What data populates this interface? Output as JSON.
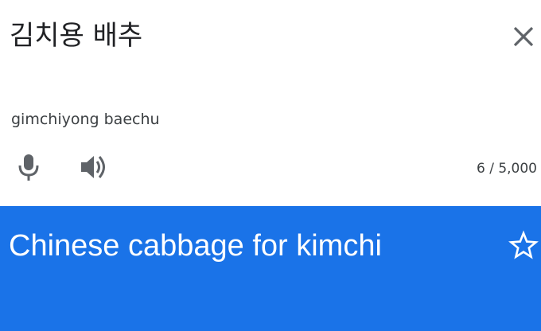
{
  "source": {
    "text": "김치용 배추",
    "transliteration": "gimchiyong baechu",
    "char_count": "6 / 5,000",
    "close_icon": "close-icon",
    "mic_icon": "microphone-icon",
    "speaker_icon": "speaker-icon"
  },
  "result": {
    "text": "Chinese cabbage for kimchi",
    "star_icon": "star-outline-icon"
  },
  "colors": {
    "accent": "#1a73e8",
    "icon": "#5f6368",
    "text_primary": "#202124"
  }
}
